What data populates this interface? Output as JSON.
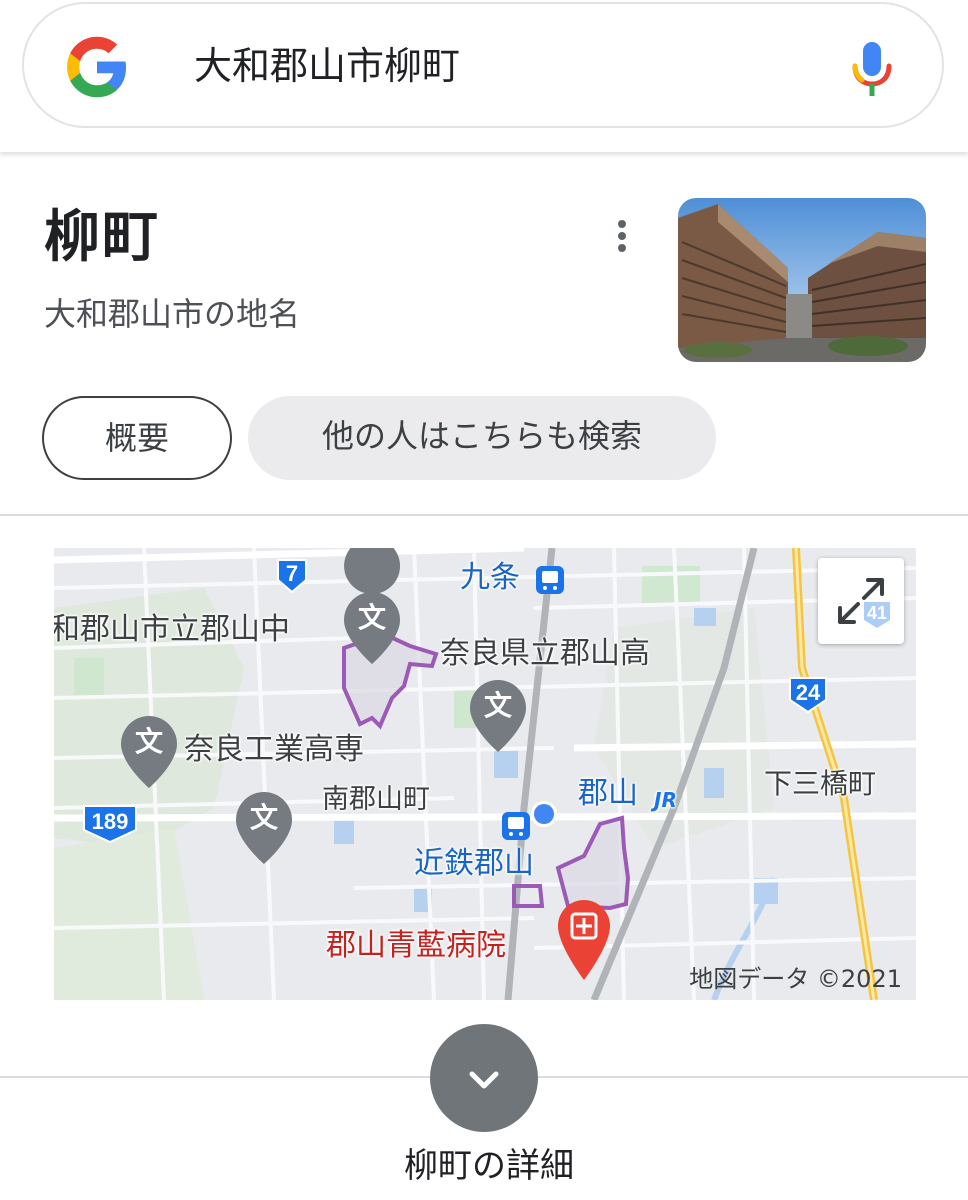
{
  "search": {
    "query": "大和郡山市柳町"
  },
  "knowledge_panel": {
    "title": "柳町",
    "subtitle": "大和郡山市の地名",
    "chips": [
      "概要",
      "他の人はこちらも検索"
    ]
  },
  "map": {
    "labels": {
      "kujo": "九条",
      "school_middle": "和郡山市立郡山中",
      "school_high": "奈良県立郡山高",
      "school_tech": "奈良工業高専",
      "minami_koriyama": "南郡山町",
      "koriyama": "郡山",
      "kintetsu": "近鉄郡山",
      "hospital": "郡山青藍病院",
      "shimo_sankyo": "下三橋町"
    },
    "school_glyph": "文",
    "jr_mark": "JR",
    "route_shields": [
      "7",
      "24",
      "189",
      "41"
    ],
    "attribution": "地図データ ©2021"
  },
  "footer": {
    "details_label": "柳町の詳細"
  },
  "colors": {
    "map_label_blue": "#1a64c8",
    "hospital_red": "#c5221f",
    "route_shield_blue": "#1a73e8",
    "boundary_purple": "#9c5ab7"
  }
}
